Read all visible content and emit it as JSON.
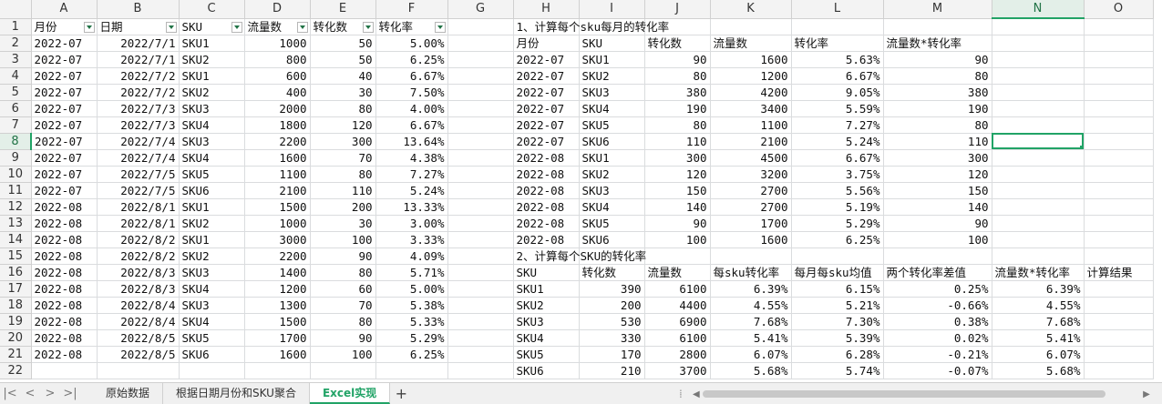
{
  "columns": [
    "A",
    "B",
    "C",
    "D",
    "E",
    "F",
    "G",
    "H",
    "I",
    "J",
    "K",
    "L",
    "M",
    "N",
    "O"
  ],
  "selected_cell": {
    "col": "N",
    "row": "8"
  },
  "accent_color": "#21a366",
  "header_row": [
    "月份",
    "日期",
    "SKU",
    "流量数",
    "转化数",
    "转化率",
    "",
    "",
    "",
    "",
    "",
    "",
    "",
    "",
    ""
  ],
  "rows": [
    {
      "rn": "2",
      "cells": [
        "2022-07",
        "2022/7/1",
        "SKU1",
        "1000",
        "50",
        "5.00%",
        "",
        "月份",
        "SKU",
        "转化数",
        "流量数",
        "转化率",
        "流量数*转化率",
        "",
        ""
      ]
    },
    {
      "rn": "3",
      "cells": [
        "2022-07",
        "2022/7/1",
        "SKU2",
        "800",
        "50",
        "6.25%",
        "",
        "2022-07",
        "SKU1",
        "90",
        "1600",
        "5.63%",
        "90",
        "",
        ""
      ]
    },
    {
      "rn": "4",
      "cells": [
        "2022-07",
        "2022/7/2",
        "SKU1",
        "600",
        "40",
        "6.67%",
        "",
        "2022-07",
        "SKU2",
        "80",
        "1200",
        "6.67%",
        "80",
        "",
        ""
      ]
    },
    {
      "rn": "5",
      "cells": [
        "2022-07",
        "2022/7/2",
        "SKU2",
        "400",
        "30",
        "7.50%",
        "",
        "2022-07",
        "SKU3",
        "380",
        "4200",
        "9.05%",
        "380",
        "",
        ""
      ]
    },
    {
      "rn": "6",
      "cells": [
        "2022-07",
        "2022/7/3",
        "SKU3",
        "2000",
        "80",
        "4.00%",
        "",
        "2022-07",
        "SKU4",
        "190",
        "3400",
        "5.59%",
        "190",
        "",
        ""
      ]
    },
    {
      "rn": "7",
      "cells": [
        "2022-07",
        "2022/7/3",
        "SKU4",
        "1800",
        "120",
        "6.67%",
        "",
        "2022-07",
        "SKU5",
        "80",
        "1100",
        "7.27%",
        "80",
        "",
        ""
      ]
    },
    {
      "rn": "8",
      "cells": [
        "2022-07",
        "2022/7/4",
        "SKU3",
        "2200",
        "300",
        "13.64%",
        "",
        "2022-07",
        "SKU6",
        "110",
        "2100",
        "5.24%",
        "110",
        "",
        ""
      ]
    },
    {
      "rn": "9",
      "cells": [
        "2022-07",
        "2022/7/4",
        "SKU4",
        "1600",
        "70",
        "4.38%",
        "",
        "2022-08",
        "SKU1",
        "300",
        "4500",
        "6.67%",
        "300",
        "",
        ""
      ]
    },
    {
      "rn": "10",
      "cells": [
        "2022-07",
        "2022/7/5",
        "SKU5",
        "1100",
        "80",
        "7.27%",
        "",
        "2022-08",
        "SKU2",
        "120",
        "3200",
        "3.75%",
        "120",
        "",
        ""
      ]
    },
    {
      "rn": "11",
      "cells": [
        "2022-07",
        "2022/7/5",
        "SKU6",
        "2100",
        "110",
        "5.24%",
        "",
        "2022-08",
        "SKU3",
        "150",
        "2700",
        "5.56%",
        "150",
        "",
        ""
      ]
    },
    {
      "rn": "12",
      "cells": [
        "2022-08",
        "2022/8/1",
        "SKU1",
        "1500",
        "200",
        "13.33%",
        "",
        "2022-08",
        "SKU4",
        "140",
        "2700",
        "5.19%",
        "140",
        "",
        ""
      ]
    },
    {
      "rn": "13",
      "cells": [
        "2022-08",
        "2022/8/1",
        "SKU2",
        "1000",
        "30",
        "3.00%",
        "",
        "2022-08",
        "SKU5",
        "90",
        "1700",
        "5.29%",
        "90",
        "",
        ""
      ]
    },
    {
      "rn": "14",
      "cells": [
        "2022-08",
        "2022/8/2",
        "SKU1",
        "3000",
        "100",
        "3.33%",
        "",
        "2022-08",
        "SKU6",
        "100",
        "1600",
        "6.25%",
        "100",
        "",
        ""
      ]
    },
    {
      "rn": "15",
      "cells": [
        "2022-08",
        "2022/8/2",
        "SKU2",
        "2200",
        "90",
        "4.09%",
        "",
        "",
        "",
        "",
        "",
        "",
        "",
        "",
        ""
      ]
    },
    {
      "rn": "16",
      "cells": [
        "2022-08",
        "2022/8/3",
        "SKU3",
        "1400",
        "80",
        "5.71%",
        "",
        "SKU",
        "转化数",
        "流量数",
        "每sku转化率",
        "每月每sku均值",
        "两个转化率差值",
        "流量数*转化率",
        "计算结果"
      ]
    },
    {
      "rn": "17",
      "cells": [
        "2022-08",
        "2022/8/3",
        "SKU4",
        "1200",
        "60",
        "5.00%",
        "",
        "SKU1",
        "390",
        "6100",
        "6.39%",
        "6.15%",
        "0.25%",
        "6.39%",
        ""
      ]
    },
    {
      "rn": "18",
      "cells": [
        "2022-08",
        "2022/8/4",
        "SKU3",
        "1300",
        "70",
        "5.38%",
        "",
        "SKU2",
        "200",
        "4400",
        "4.55%",
        "5.21%",
        "-0.66%",
        "4.55%",
        ""
      ]
    },
    {
      "rn": "19",
      "cells": [
        "2022-08",
        "2022/8/4",
        "SKU4",
        "1500",
        "80",
        "5.33%",
        "",
        "SKU3",
        "530",
        "6900",
        "7.68%",
        "7.30%",
        "0.38%",
        "7.68%",
        ""
      ]
    },
    {
      "rn": "20",
      "cells": [
        "2022-08",
        "2022/8/5",
        "SKU5",
        "1700",
        "90",
        "5.29%",
        "",
        "SKU4",
        "330",
        "6100",
        "5.41%",
        "5.39%",
        "0.02%",
        "5.41%",
        ""
      ]
    },
    {
      "rn": "21",
      "cells": [
        "2022-08",
        "2022/8/5",
        "SKU6",
        "1600",
        "100",
        "6.25%",
        "",
        "SKU5",
        "170",
        "2800",
        "6.07%",
        "6.28%",
        "-0.21%",
        "6.07%",
        ""
      ]
    },
    {
      "rn": "22",
      "cells": [
        "",
        "",
        "",
        "",
        "",
        "",
        "",
        "SKU6",
        "210",
        "3700",
        "5.68%",
        "5.74%",
        "-0.07%",
        "5.68%",
        ""
      ]
    }
  ],
  "section_titles": {
    "s1": "1、计算每个sku每月的转化率",
    "s2": "2、计算每个SKU的转化率"
  },
  "sheet_tabs": [
    "原始数据",
    "根据日期月份和SKU聚合",
    "Excel实现"
  ],
  "active_tab": "Excel实现",
  "nav_icons": [
    "first-sheet-icon",
    "prev-sheet-icon",
    "next-sheet-icon",
    "last-sheet-icon"
  ],
  "add_tab_label": "+"
}
